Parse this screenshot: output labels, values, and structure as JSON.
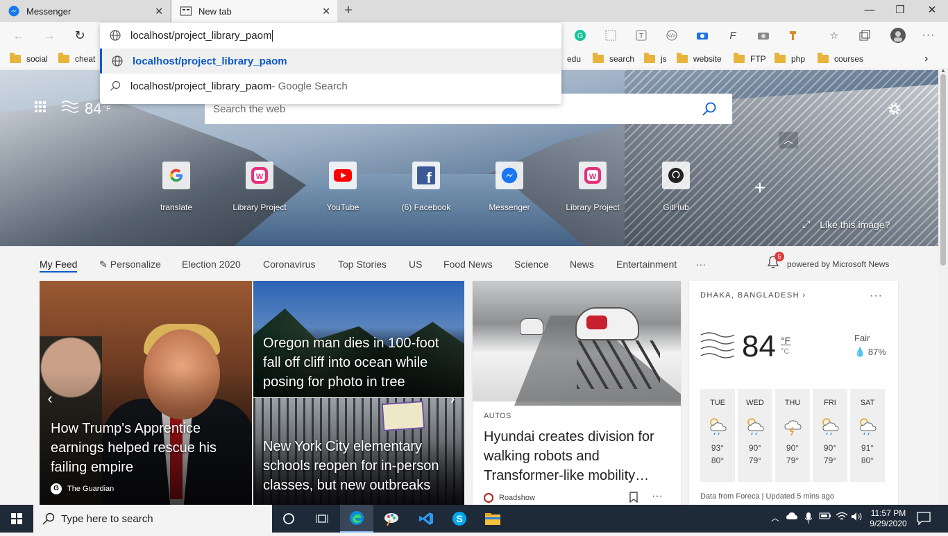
{
  "browser": {
    "tabs": [
      {
        "title": "Messenger",
        "active": false
      },
      {
        "title": "New tab",
        "active": true
      }
    ],
    "address_input": "localhost/project_library_paom",
    "suggestions": [
      {
        "text": "localhost/project_library_paom",
        "suffix": "",
        "icon": "globe-icon",
        "selected": true
      },
      {
        "text": "localhost/project_library_paom",
        "suffix": " - Google Search",
        "icon": "search-icon",
        "selected": false
      }
    ],
    "bookmarks": [
      {
        "label": "social"
      },
      {
        "label": "cheat"
      },
      {
        "label": "edu"
      },
      {
        "label": "search"
      },
      {
        "label": "js"
      },
      {
        "label": "website"
      },
      {
        "label": "FTP"
      },
      {
        "label": "php"
      },
      {
        "label": "courses"
      }
    ]
  },
  "newtab": {
    "weather_temp": "84",
    "weather_unit": "°F",
    "search_placeholder": "Search the web",
    "quick_links": [
      {
        "label": "translate",
        "icon": "google-icon"
      },
      {
        "label": "Library Project",
        "icon": "wampserver-icon"
      },
      {
        "label": "YouTube",
        "icon": "youtube-icon"
      },
      {
        "label": "(6) Facebook",
        "icon": "facebook-icon"
      },
      {
        "label": "Messenger",
        "icon": "messenger-icon"
      },
      {
        "label": "Library Project",
        "icon": "wampserver-icon"
      },
      {
        "label": "GitHub",
        "icon": "github-icon"
      }
    ],
    "like_image": "Like this image?",
    "feed_tabs": [
      {
        "label": "My Feed",
        "active": true
      },
      {
        "label": "Personalize"
      },
      {
        "label": "Election 2020"
      },
      {
        "label": "Coronavirus"
      },
      {
        "label": "Top Stories"
      },
      {
        "label": "US"
      },
      {
        "label": "Food News"
      },
      {
        "label": "Science"
      },
      {
        "label": "News"
      },
      {
        "label": "Entertainment"
      }
    ],
    "feed_more": "···",
    "notification_count": "5",
    "powered_by": "powered by Microsoft News"
  },
  "cards": {
    "trump": {
      "headline": "How Trump's Apprentice earnings helped rescue his failing empire",
      "source": "The Guardian",
      "source_icon": "G"
    },
    "oregon": {
      "headline": "Oregon man dies in 100-foot fall off cliff into ocean while posing for photo in tree"
    },
    "nyc": {
      "headline": "New York City elementary schools reopen for in-person classes, but new outbreaks"
    },
    "hyundai": {
      "category": "AUTOS",
      "headline": "Hyundai creates division for walking robots and Transformer-like mobility…",
      "source": "Roadshow"
    }
  },
  "weather": {
    "location": "DHAKA, BANGLADESH",
    "temp": "84",
    "unit_f": "°F",
    "unit_c": "°C",
    "condition": "Fair",
    "humidity": "87%",
    "forecast": [
      {
        "day": "TUE",
        "hi": "93°",
        "lo": "80°",
        "icon": "rain-sun-icon"
      },
      {
        "day": "WED",
        "hi": "90°",
        "lo": "79°",
        "icon": "rain-sun-icon"
      },
      {
        "day": "THU",
        "hi": "90°",
        "lo": "79°",
        "icon": "thunderstorm-icon"
      },
      {
        "day": "FRI",
        "hi": "90°",
        "lo": "79°",
        "icon": "rain-sun-icon"
      },
      {
        "day": "SAT",
        "hi": "91°",
        "lo": "80°",
        "icon": "rain-sun-icon"
      }
    ],
    "footer": "Data from Foreca | Updated 5 mins ago"
  },
  "taskbar": {
    "search_placeholder": "Type here to search",
    "time": "11:57 PM",
    "date": "9/29/2020"
  },
  "colors": {
    "accent": "#0a59c9",
    "taskbar": "#1f2a38"
  }
}
